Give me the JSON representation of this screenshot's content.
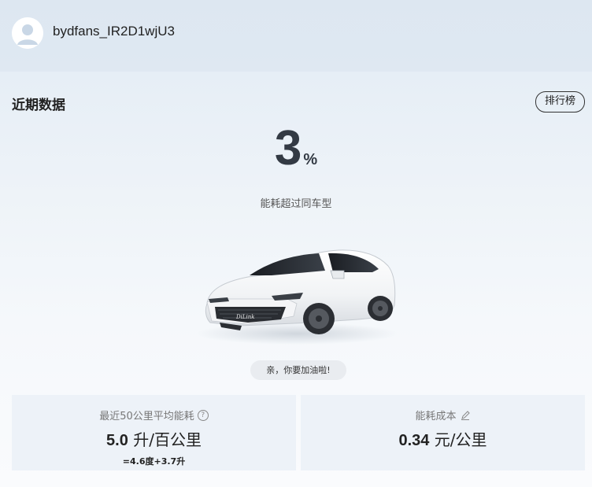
{
  "header": {
    "username": "bydfans_IR2D1wjU3",
    "avatar_icon": "user-avatar-icon"
  },
  "recent": {
    "title": "近期数据",
    "ranking_label": "排行榜",
    "percent_value": "3",
    "percent_sign": "%",
    "percent_label": "能耗超过同车型",
    "tip": "亲，你要加油啦!",
    "car_badge": "DiLink"
  },
  "stats": {
    "avg": {
      "label": "最近50公里平均能耗",
      "icon": "help-icon",
      "value": "5.0",
      "unit": "升/百公里",
      "breakdown": "=4.6度+3.7升"
    },
    "cost": {
      "label": "能耗成本",
      "icon": "edit-pen-icon",
      "value": "0.34",
      "unit": "元/公里"
    }
  },
  "colors": {
    "header_bg": "#dde7f1",
    "card_bg_top": "#e6eef6",
    "text_dark": "#222222",
    "text_muted": "#777777"
  }
}
